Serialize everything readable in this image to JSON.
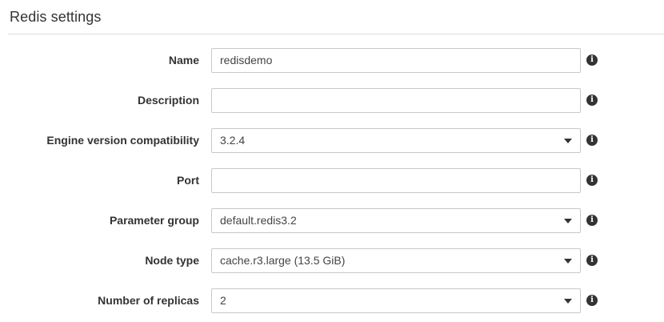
{
  "section": {
    "title": "Redis settings"
  },
  "fields": [
    {
      "label": "Name",
      "type": "text",
      "value": "redisdemo",
      "info_icon": "info-circle-icon"
    },
    {
      "label": "Description",
      "type": "text",
      "value": "",
      "info_icon": "info-circle-icon"
    },
    {
      "label": "Engine version compatibility",
      "type": "select",
      "value": "3.2.4",
      "info_icon": "info-circle-icon"
    },
    {
      "label": "Port",
      "type": "text",
      "value": "",
      "info_icon": "info-circle-icon"
    },
    {
      "label": "Parameter group",
      "type": "select",
      "value": "default.redis3.2",
      "info_icon": "info-circle-icon"
    },
    {
      "label": "Node type",
      "type": "select",
      "value": "cache.r3.large (13.5 GiB)",
      "info_icon": "info-circle-icon"
    },
    {
      "label": "Number of replicas",
      "type": "select",
      "value": "2",
      "info_icon": "info-circle-icon"
    }
  ],
  "colors": {
    "text": "#333333",
    "border": "#c8c8c8",
    "divider": "#dddddd",
    "icon": "#333333"
  }
}
